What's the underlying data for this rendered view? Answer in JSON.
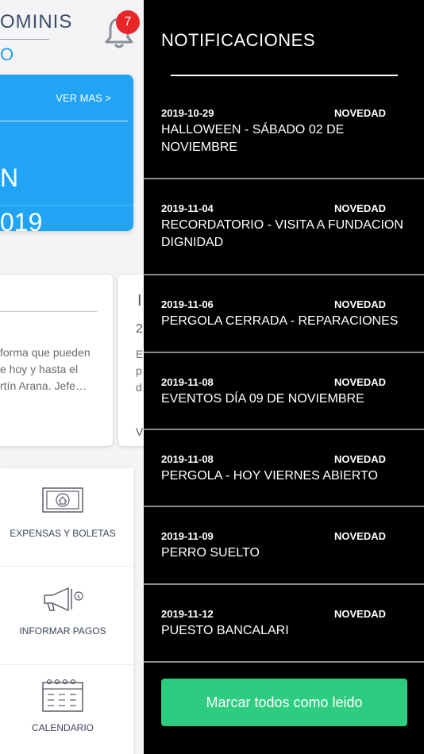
{
  "background": {
    "header_title": "OMINIS",
    "header_subtitle": "O",
    "notification_count": "7",
    "featured_card": {
      "link": "VER MAS >",
      "line1": "N",
      "line2": "019"
    },
    "news_card": {
      "text_lines": [
        "forma que pueden",
        "e hoy y hasta el",
        "rtín Arana. Jefe…"
      ]
    },
    "news_card_2": {
      "t1": "I",
      "t2": "2",
      "t3_lines": [
        "E",
        "p",
        "d"
      ],
      "t4": "V"
    },
    "menu": [
      {
        "label": "EXPENSAS Y BOLETAS",
        "icon": "banknote-icon"
      },
      {
        "label": "INFORMAR PAGOS",
        "icon": "megaphone-icon"
      },
      {
        "label": "CALENDARIO",
        "icon": "calendar-icon"
      }
    ]
  },
  "drawer": {
    "title": "NOTIFICACIONES",
    "notifications": [
      {
        "date": "2019-10-29",
        "tag": "NOVEDAD",
        "title": "HALLOWEEN - SÁBADO 02 DE NOVIEMBRE"
      },
      {
        "date": "2019-11-04",
        "tag": "NOVEDAD",
        "title": "RECORDATORIO - VISITA A FUNDACION DIGNIDAD"
      },
      {
        "date": "2019-11-06",
        "tag": "NOVEDAD",
        "title": "PERGOLA CERRADA - REPARACIONES"
      },
      {
        "date": "2019-11-08",
        "tag": "NOVEDAD",
        "title": "EVENTOS DÍA 09 DE NOVIEMBRE"
      },
      {
        "date": "2019-11-08",
        "tag": "NOVEDAD",
        "title": "PERGOLA - HOY VIERNES ABIERTO"
      },
      {
        "date": "2019-11-09",
        "tag": "NOVEDAD",
        "title": "PERRO SUELTO"
      },
      {
        "date": "2019-11-12",
        "tag": "NOVEDAD",
        "title": "PUESTO BANCALARI"
      }
    ],
    "mark_all_label": "Marcar todos como leido"
  },
  "colors": {
    "accent_blue": "#21a4f4",
    "badge_red": "#e8262a",
    "button_green": "#2ecc80",
    "drawer_bg": "#000000"
  }
}
